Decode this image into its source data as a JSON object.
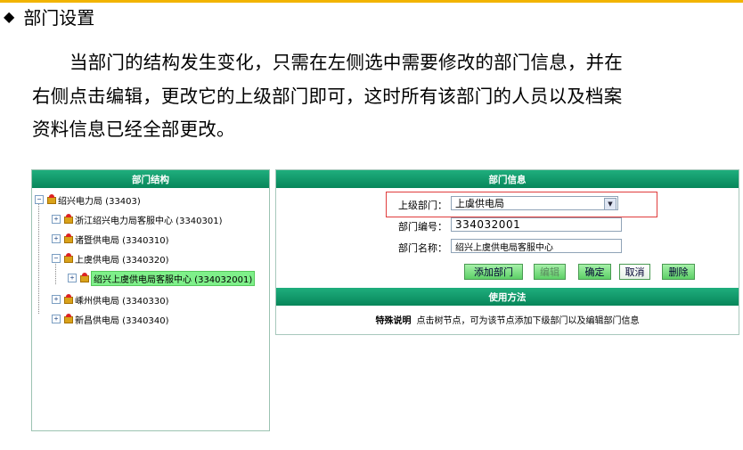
{
  "doc": {
    "heading_bullet": "◆",
    "heading": "部门设置",
    "line1": "当部门的结构发生变化，只需在左侧选中需要修改的部门信息，并在",
    "line2": "右侧点击编辑，更改它的上级部门即可，这时所有该部门的人员以及档案",
    "line3": "资料信息已经全部更改。"
  },
  "left_panel": {
    "title": "部门结构",
    "tree": [
      {
        "label": "绍兴电力局 (33403)",
        "toggle": "−"
      },
      {
        "label": "浙江绍兴电力局客服中心 (3340301)",
        "toggle": "+"
      },
      {
        "label": "诸暨供电局 (3340310)",
        "toggle": "+"
      },
      {
        "label": "上虞供电局 (3340320)",
        "toggle": "−"
      },
      {
        "label": "绍兴上虞供电局客服中心 (334032001)",
        "toggle": "+",
        "selected": true
      },
      {
        "label": "嵊州供电局 (3340330)",
        "toggle": "+"
      },
      {
        "label": "新昌供电局 (3340340)",
        "toggle": "+"
      }
    ]
  },
  "right_panel": {
    "title": "部门信息",
    "parent_label": "上级部门：",
    "parent_value": "上虞供电局",
    "code_label": "部门编号：",
    "code_value": "334032001",
    "name_label": "部门名称：",
    "name_value": "绍兴上虞供电局客服中心",
    "buttons": {
      "add": "添加部门",
      "edit": "编辑",
      "confirm": "确定",
      "cancel": "取消",
      "delete": "删除"
    },
    "usage_title": "使用方法",
    "usage_bold": "特殊说明",
    "usage_text": "点击树节点，可为该节点添加下级部门以及编辑部门信息"
  },
  "colors": {
    "header_green": "#07865a",
    "selected_highlight": "#7ff08a",
    "red_outline": "#e03c3c",
    "top_rule": "#f2b400"
  },
  "icons": [
    "gift-folder-icon",
    "tree-toggle-icon",
    "dropdown-arrow-icon"
  ]
}
